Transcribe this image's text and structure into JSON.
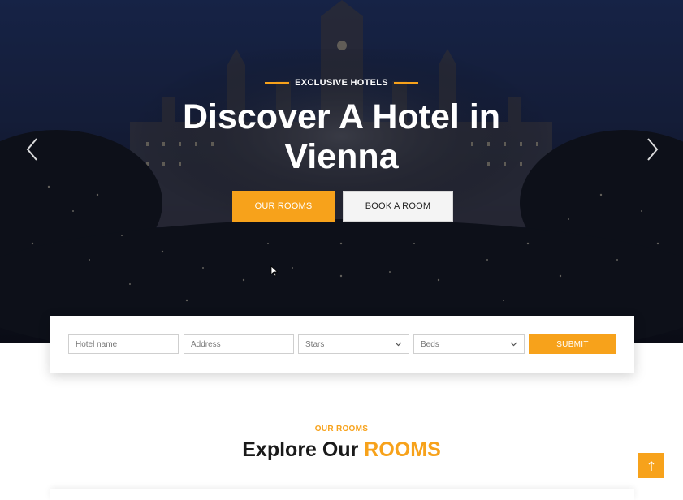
{
  "hero": {
    "subtitle": "EXCLUSIVE HOTELS",
    "title": "Discover A Hotel in Vienna",
    "primary_button": "OUR ROOMS",
    "secondary_button": "BOOK A ROOM",
    "prev_icon": "chevron-left-icon",
    "next_icon": "chevron-right-icon"
  },
  "search": {
    "hotel_placeholder": "Hotel name",
    "address_placeholder": "Address",
    "stars_selected": "Stars",
    "beds_selected": "Beds",
    "submit_label": "SUBMIT"
  },
  "rooms_section": {
    "label": "OUR ROOMS",
    "title_prefix": "Explore Our ",
    "title_accent": "ROOMS"
  },
  "scroll_top": {
    "icon": "arrow-up-icon"
  },
  "colors": {
    "accent": "#f7a21b",
    "hero_dark": "#1a2647",
    "text_dark": "#1a1a1a"
  }
}
